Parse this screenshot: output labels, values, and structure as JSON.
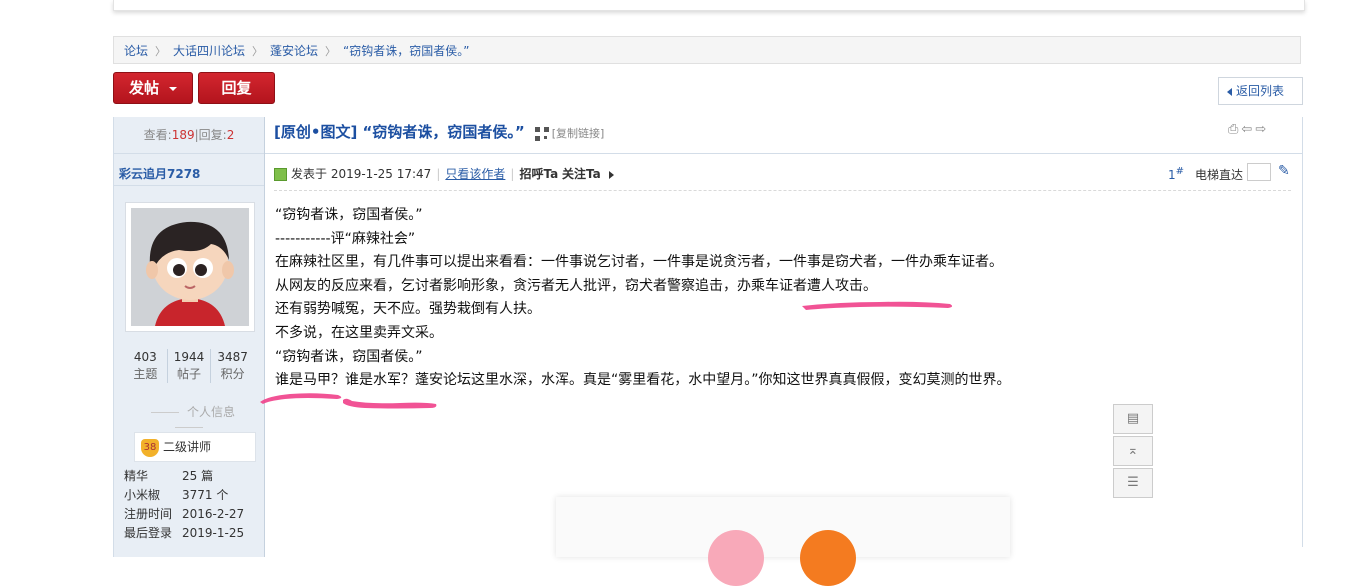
{
  "breadcrumb": [
    "论坛",
    "大话四川论坛",
    "蓬安论坛",
    "“窃钩者诛，窃国者侯。”"
  ],
  "buttons": {
    "post": "发帖",
    "reply": "回复",
    "back": "返回列表"
  },
  "stats": {
    "views_label": "查看:",
    "views": "189",
    "sep": "|",
    "replies_label": "回复:",
    "replies": "2"
  },
  "user": {
    "name": "彩云追月7278",
    "counts": [
      {
        "value": "403",
        "label": "主题"
      },
      {
        "value": "1944",
        "label": "帖子"
      },
      {
        "value": "3487",
        "label": "积分"
      }
    ],
    "info_title": "个人信息",
    "rank_badge": "38",
    "rank": "二级讲师",
    "meta": [
      {
        "k": "精华",
        "v": "25 篇"
      },
      {
        "k": "小米椒",
        "v": "3771 个"
      },
      {
        "k": "注册时间",
        "v": "2016-2-27"
      },
      {
        "k": "最后登录",
        "v": "2019-1-25"
      }
    ]
  },
  "post": {
    "title": "[原创•图文] “窃钩者诛，窃国者侯。”",
    "copy_link": "[复制链接]",
    "posted_at": "发表于 2019-1-25 17:47",
    "only_author": "只看该作者",
    "greet": "招呼Ta",
    "follow": "关注Ta",
    "floor": "1",
    "floor_sup": "#",
    "jump_label": "电梯直达",
    "lines": [
      "“窃钩者诛，窃国者侯。”",
      "-----------评“麻辣社会”",
      "在麻辣社区里，有几件事可以提出来看看：一件事说乞讨者，一件事是说贪污者，一件事是窃犬者，一件办乘车证者。",
      "从网友的反应来看，乞讨者影响形象，贪污者无人批评，窃犬者警察追击，办乘车证者遭人攻击。",
      "还有弱势喊冤，天不应。强势栽倒有人扶。",
      "不多说，在这里卖弄文采。",
      "“窃钩者诛，窃国者侯。”",
      "谁是马甲？谁是水军？蓬安论坛这里水深，水浑。真是“雾里看花，水中望月。”你知这世界真真假假，变幻莫测的世界。"
    ]
  },
  "colors": {
    "accent": "#2a5ca6",
    "button_red": "#c41e26",
    "annotation_pink": "#f0408a"
  },
  "icons": [
    "print-icon",
    "prev-icon",
    "next-icon",
    "qr-code-icon",
    "edit-icon",
    "comment-icon",
    "top-icon",
    "list-icon"
  ]
}
